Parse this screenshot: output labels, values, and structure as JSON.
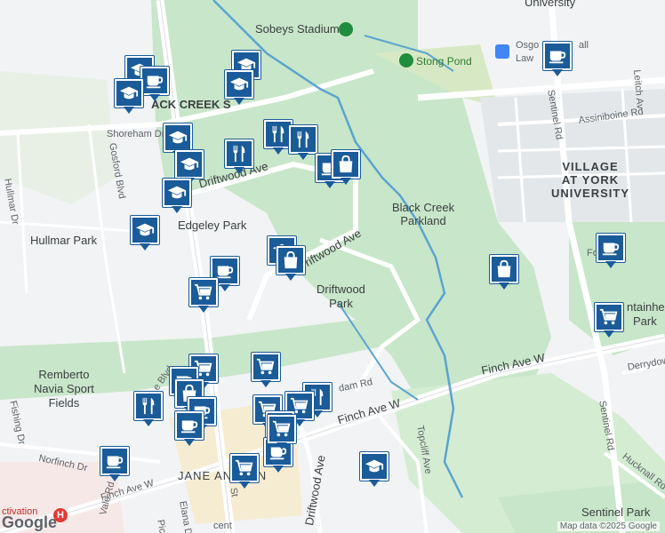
{
  "map": {
    "labels": {
      "sobeys": "Sobeys Stadium",
      "york": "University",
      "osgoode1": "Osgo",
      "osgoode2": "all",
      "osgoode3": "Law",
      "stong": "Stong Pond",
      "blackcreek_sw": "ACK CREEK S",
      "shoreham_dr": "Shoreham Dr",
      "gosford": "Gosford Blvd",
      "hullmar_dr": "Hullmar Dr",
      "driftwood_ave_top": "Driftwood Ave",
      "edgeley": "Edgeley Park",
      "hullmar_park": "Hullmar Park",
      "driftwood_ave_mid": "riftwood Ave",
      "driftwood_park": "Driftwood\nPark",
      "black_creek_parkland": "Black Creek\nParkland",
      "village": "VILLAGE\nAT YORK\nUNIVERSITY",
      "sentinel_rd_top": "Sentinel Rd",
      "assiniboine": "Assiniboine Rd",
      "leitch": "Leitch Av",
      "fountain": "Fou",
      "fountainhead": "ntainhea",
      "park_right": "Park",
      "remberto": "Remberto\nNavia Sport\nFields",
      "finch_ave_w_main": "Finch Ave W",
      "finch_ave_w_mid": "Finch Ave W",
      "finch_ave_w_left": "Finch Ave W",
      "norfinch": "Norfinch Dr",
      "jane_finch": "JANE AND FIN",
      "elana": "Elana Dr",
      "driftwood_ave_low": "Driftwood Ave",
      "topcliff": "Topcliff Ave",
      "sentinel_rd_low": "Sentinel Rd",
      "derrydown": "Derrydown R",
      "hucknall": "Hucknall Rd",
      "sentinel_park": "Sentinel Park",
      "dam_rd": "dam Rd",
      "pica": "Pica",
      "activation": "ctivation",
      "vale": "Vale Rd",
      "st": "St",
      "jane_blvd": "e Blvd",
      "fishing": "Fishing Dr",
      "cr": "cent"
    },
    "attribution": "Map data ©2025 Google",
    "logo": "Google",
    "markers": [
      {
        "icon": "graduation-cap",
        "id": "m1"
      },
      {
        "icon": "coffee-cup",
        "id": "m2"
      },
      {
        "icon": "graduation-cap",
        "id": "m3"
      },
      {
        "icon": "graduation-cap",
        "id": "m4"
      },
      {
        "icon": "graduation-cap",
        "id": "m5"
      },
      {
        "icon": "graduation-cap",
        "id": "m6"
      },
      {
        "icon": "graduation-cap",
        "id": "m7"
      },
      {
        "icon": "fork-knife",
        "id": "m8"
      },
      {
        "icon": "fork-knife",
        "id": "m9"
      },
      {
        "icon": "fork-knife",
        "id": "m10"
      },
      {
        "icon": "coffee-cup",
        "id": "m11"
      },
      {
        "icon": "shopping-bag",
        "id": "m12"
      },
      {
        "icon": "graduation-cap",
        "id": "m13"
      },
      {
        "icon": "graduation-cap",
        "id": "m14"
      },
      {
        "icon": "graduation-cap",
        "id": "m15"
      },
      {
        "icon": "shopping-bag",
        "id": "m16"
      },
      {
        "icon": "coffee-cup",
        "id": "m17"
      },
      {
        "icon": "shopping-cart",
        "id": "m18"
      },
      {
        "icon": "coffee-cup",
        "id": "m19"
      },
      {
        "icon": "coffee-cup",
        "id": "m20"
      },
      {
        "icon": "shopping-bag",
        "id": "m21"
      },
      {
        "icon": "shopping-cart",
        "id": "m22"
      },
      {
        "icon": "shopping-cart",
        "id": "m23"
      },
      {
        "icon": "shopping-cart",
        "id": "m24"
      },
      {
        "icon": "coffee-cup",
        "id": "m25"
      },
      {
        "icon": "shopping-bag",
        "id": "m26"
      },
      {
        "icon": "fork-knife",
        "id": "m27"
      },
      {
        "icon": "fork-knife",
        "id": "m28"
      },
      {
        "icon": "shopping-cart",
        "id": "m29"
      },
      {
        "icon": "coffee-cup",
        "id": "m30"
      },
      {
        "icon": "shopping-cart",
        "id": "m31"
      },
      {
        "icon": "coffee-cup",
        "id": "m32"
      },
      {
        "icon": "graduation-cap",
        "id": "m33"
      }
    ],
    "colors": {
      "marker": "#1a5b99",
      "park": "#c8e6c9",
      "road": "#ffffff",
      "water": "#5ba4cf",
      "land": "#f1f3f4"
    }
  }
}
